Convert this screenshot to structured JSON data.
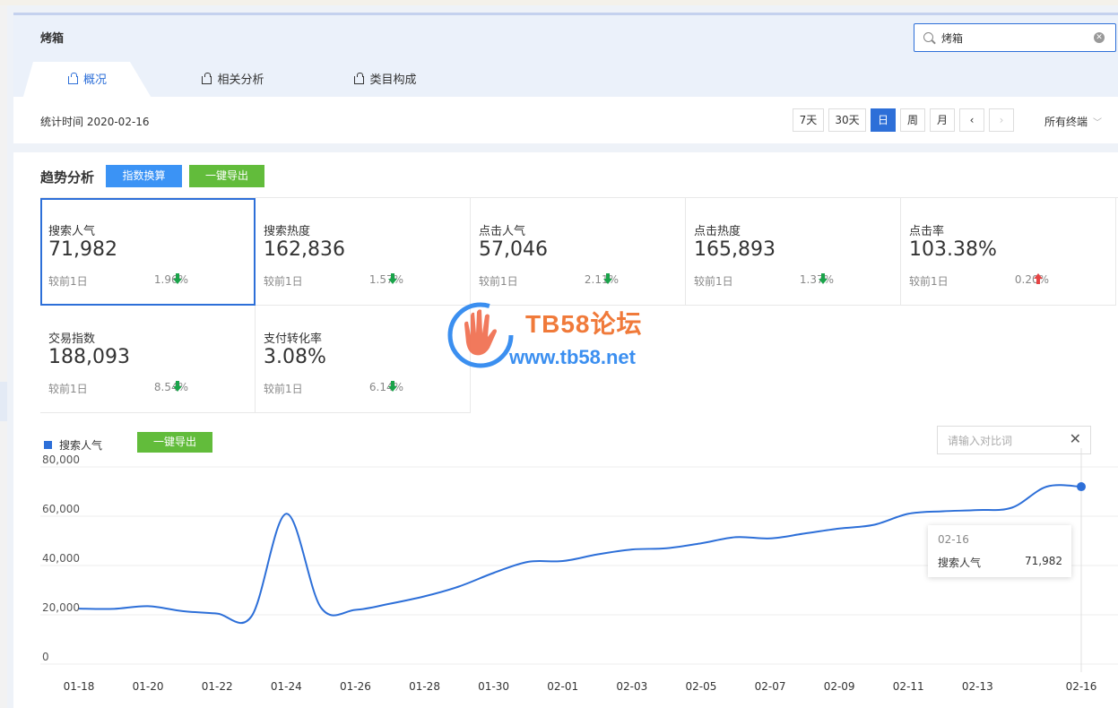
{
  "keyword": "烤箱",
  "search": {
    "value": "烤箱"
  },
  "tabs": [
    {
      "label": "概况",
      "active": true
    },
    {
      "label": "相关分析",
      "active": false
    },
    {
      "label": "类目构成",
      "active": false
    }
  ],
  "stat_date": "统计时间 2020-02-16",
  "period_buttons": [
    "7天",
    "30天",
    "日",
    "周",
    "月"
  ],
  "nav": {
    "prev": "‹",
    "next": "›"
  },
  "terminal": {
    "label": "所有终端",
    "chevron": "﹀"
  },
  "trend": {
    "title": "趋势分析",
    "index_convert_label": "指数换算",
    "export_label": "一键导出"
  },
  "metrics": [
    {
      "name": "搜索人气",
      "value": "71,982",
      "compare": "较前1日",
      "pct": "1.96%",
      "direction": "down"
    },
    {
      "name": "搜索热度",
      "value": "162,836",
      "compare": "较前1日",
      "pct": "1.57%",
      "direction": "down"
    },
    {
      "name": "点击人气",
      "value": "57,046",
      "compare": "较前1日",
      "pct": "2.11%",
      "direction": "down"
    },
    {
      "name": "点击热度",
      "value": "165,893",
      "compare": "较前1日",
      "pct": "1.37%",
      "direction": "down"
    },
    {
      "name": "点击率",
      "value": "103.38%",
      "compare": "较前1日",
      "pct": "0.20%",
      "direction": "up"
    },
    {
      "name": "交易指数",
      "value": "188,093",
      "compare": "较前1日",
      "pct": "8.54%",
      "direction": "down"
    },
    {
      "name": "支付转化率",
      "value": "3.08%",
      "compare": "较前1日",
      "pct": "6.14%",
      "direction": "down"
    }
  ],
  "colors": {
    "accent": "#2d6fd8",
    "export_green": "#62bc3b",
    "convert_blue": "#3b93f5",
    "down": "#1aa34a",
    "up": "#e54545"
  },
  "watermark": {
    "title": "TB58论坛",
    "url": "www.tb58.net"
  },
  "chart_legend": "搜索人气",
  "chart_export_label": "一键导出",
  "compare": {
    "placeholder": "请输入对比词"
  },
  "tooltip": {
    "date": "02-16",
    "name": "搜索人气",
    "value": "71,982"
  },
  "chart_data": {
    "type": "line",
    "series": [
      {
        "name": "搜索人气",
        "x": [
          "01-18",
          "01-19",
          "01-20",
          "01-21",
          "01-22",
          "01-23",
          "01-24",
          "01-25",
          "01-26",
          "01-27",
          "01-28",
          "01-29",
          "01-30",
          "01-31",
          "02-01",
          "02-02",
          "02-03",
          "02-04",
          "02-05",
          "02-06",
          "02-07",
          "02-08",
          "02-09",
          "02-10",
          "02-11",
          "02-12",
          "02-13",
          "02-14",
          "02-15",
          "02-16"
        ],
        "values": [
          22500,
          22400,
          23500,
          21500,
          20500,
          19500,
          61000,
          23000,
          22000,
          24500,
          27500,
          31500,
          37000,
          41500,
          41800,
          44500,
          46500,
          47000,
          49000,
          51500,
          51000,
          53000,
          55000,
          56500,
          61000,
          62000,
          62500,
          63500,
          72000,
          71982
        ]
      }
    ],
    "xticks": [
      "01-18",
      "01-20",
      "01-22",
      "01-24",
      "01-26",
      "01-28",
      "01-30",
      "02-01",
      "02-03",
      "02-05",
      "02-07",
      "02-09",
      "02-11",
      "02-13",
      "02-16"
    ],
    "yticks": [
      "80,000",
      "60,000",
      "40,000",
      "20,000",
      "0"
    ],
    "ylim": [
      0,
      80000
    ],
    "grid": true
  }
}
